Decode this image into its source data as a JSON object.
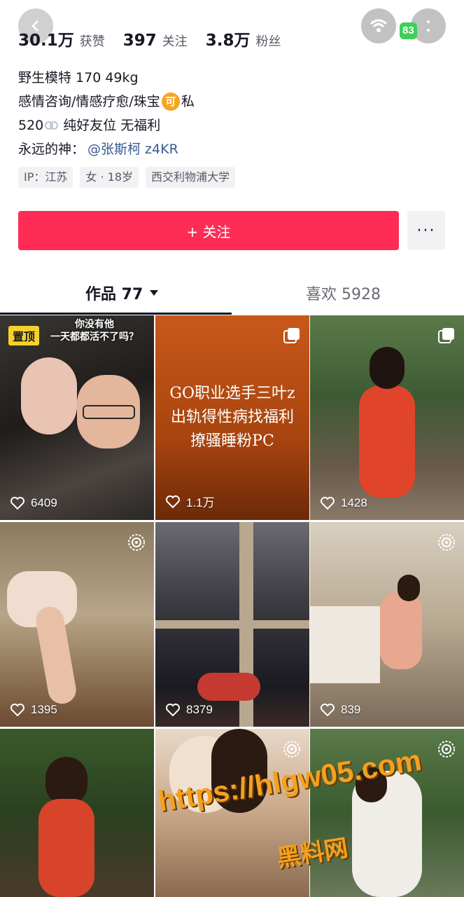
{
  "stats": [
    {
      "value": "30.1万",
      "label": "获赞"
    },
    {
      "value": "397",
      "label": "关注"
    },
    {
      "value": "3.8万",
      "label": "粉丝"
    }
  ],
  "status": {
    "battery": "83"
  },
  "bio": {
    "line1": "野生模特 170 49kg",
    "line2_prefix": "感情咨询/情感疗愈/珠宝",
    "line2_coin": "可",
    "line2_suffix": "私",
    "line3_prefix": "520",
    "line3_suffix": "纯好友位 无福利",
    "line4_prefix": "永远的神：",
    "line4_mention": "@张斯柯 z4KR"
  },
  "tags": [
    "IP：江苏",
    "女 · 18岁",
    "西交利物浦大学"
  ],
  "follow_button": "+ 关注",
  "more_button": "···",
  "tabs": {
    "works": "作品 77",
    "likes": "喜欢 5928"
  },
  "tiles": [
    {
      "likes": "6409",
      "pinned": "置顶",
      "caption": "你没有他\n一天都都活不了吗？"
    },
    {
      "likes": "1.1万",
      "overlay": "GO职业选手三叶z\n出轨得性病找福利\n撩骚睡粉PC"
    },
    {
      "likes": "1428"
    },
    {
      "likes": "1395"
    },
    {
      "likes": "8379"
    },
    {
      "likes": "839"
    },
    {
      "likes": ""
    },
    {
      "likes": ""
    },
    {
      "likes": ""
    }
  ],
  "watermark": {
    "url": "https://hlgw05.com",
    "name": "黑料网"
  },
  "colors": {
    "accent": "#fe2c55",
    "text": "#161823",
    "secondary": "#555a66"
  }
}
